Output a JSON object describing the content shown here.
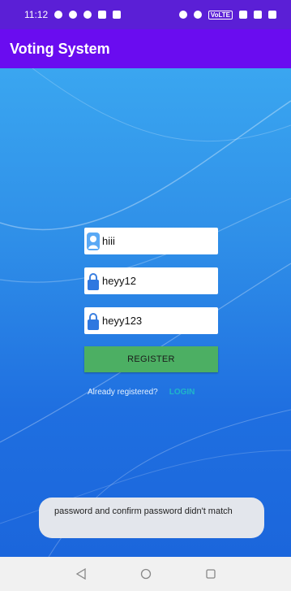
{
  "status_bar": {
    "time": "11:12",
    "network_label": "VoLTE"
  },
  "app_bar": {
    "title": "Voting System"
  },
  "form": {
    "username_value": "hiii",
    "password_value": "heyy12",
    "confirm_password_value": "heyy123",
    "register_label": "REGISTER",
    "already_registered_text": "Already registered?",
    "login_label": "LOGIN"
  },
  "toast": {
    "message": "password and confirm password didn't match"
  },
  "nav_bar": {
    "icons": [
      "back-icon",
      "home-icon",
      "recents-icon"
    ]
  },
  "colors": {
    "status_bar": "#5b1fd6",
    "app_bar": "#6a0cf0",
    "background_blue": "#2f8fe8",
    "register_button": "#4caf63",
    "login_link": "#1fb7c8",
    "toast_bg": "#e3e6ec"
  }
}
